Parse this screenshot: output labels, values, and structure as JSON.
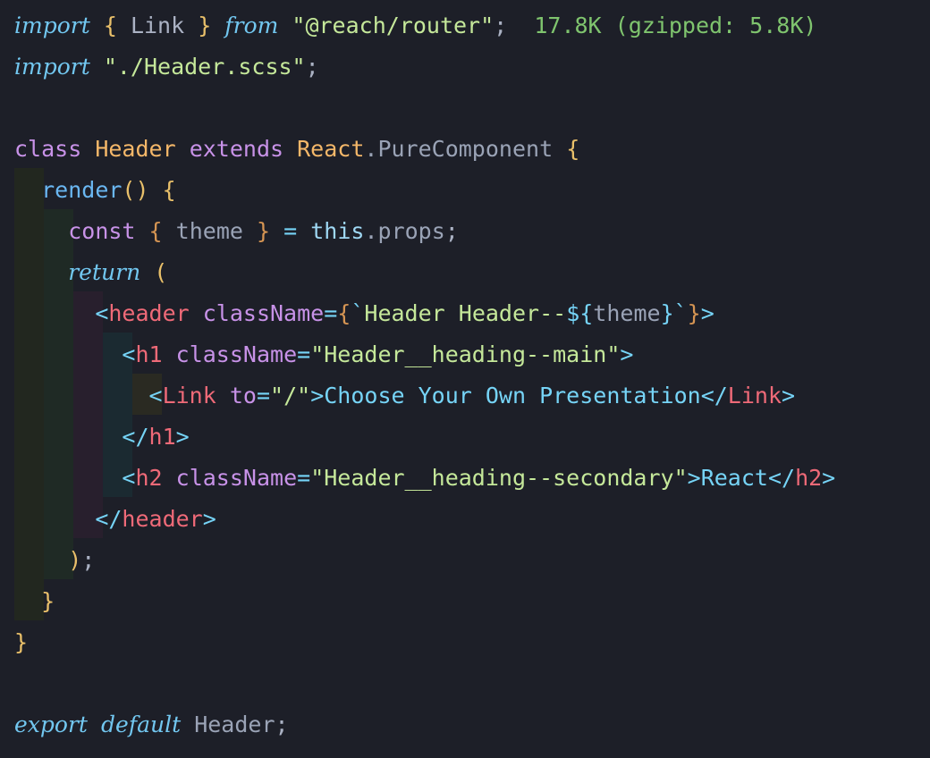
{
  "editor": {
    "theme_colors": {
      "background": "#1d1f28",
      "string": "#c5e89a",
      "keyword_italic": "#72c7f0",
      "jsx_tag": "#ef6a78",
      "jsx_attr": "#c892e8",
      "class_name": "#f4b769",
      "import_cost": "#7fc46e"
    },
    "import_cost": "17.8K (gzipped: 5.8K)",
    "tokens": {
      "import": "import",
      "from": "from",
      "link_name": "Link",
      "router_module": "\"@reach/router\"",
      "scss_module": "\"./Header.scss\"",
      "class_kw": "class",
      "header_cls": "Header",
      "extends_kw": "extends",
      "react_obj": "React",
      "pure_component": "PureComponent",
      "render_fn": "render",
      "const_kw": "const",
      "theme_var": "theme",
      "this_kw": "this",
      "props": "props",
      "return_kw": "return",
      "header_tag": "header",
      "class_name_attr": "className",
      "tpl_text": "Header Header--",
      "h1_tag": "h1",
      "h1_class": "\"Header__heading--main\"",
      "link_tag": "Link",
      "to_attr": "to",
      "to_value": "\"/\"",
      "link_text": "Choose Your Own Presentation",
      "h2_tag": "h2",
      "h2_class": "\"Header__heading--secondary\"",
      "h2_text": "React",
      "export_kw": "export",
      "default_kw": "default",
      "export_name": "Header"
    }
  }
}
